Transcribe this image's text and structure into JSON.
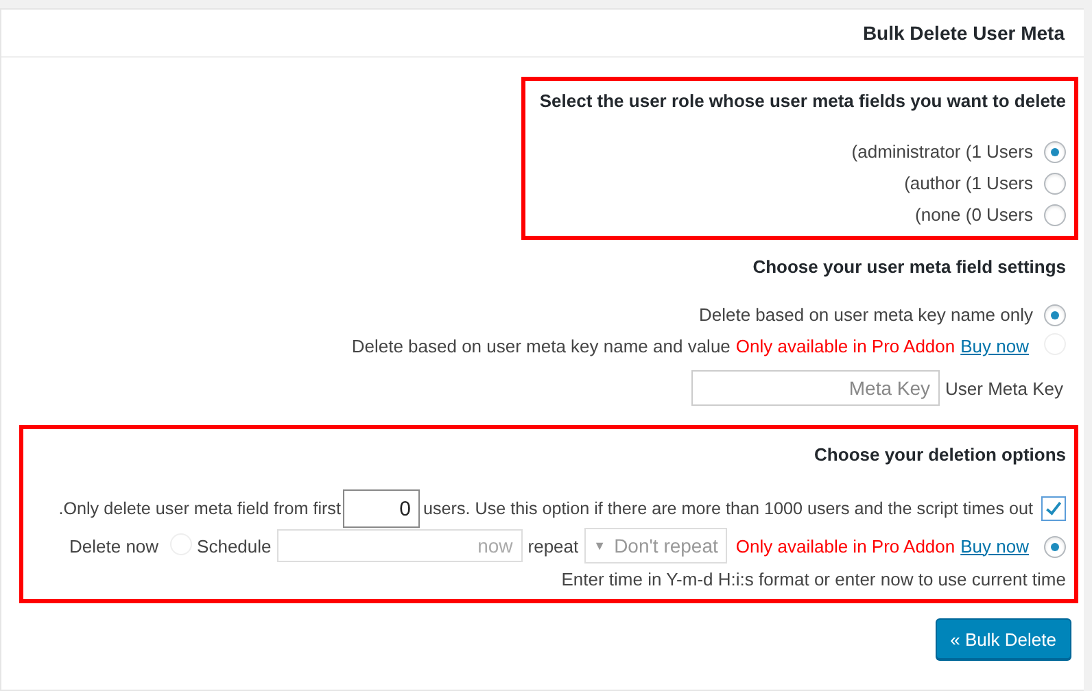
{
  "header": {
    "title": "Bulk Delete User Meta"
  },
  "role_section": {
    "highlighted": true,
    "title": "Select the user role whose user meta fields you want to delete",
    "roles": [
      {
        "label": "(administrator (1 Users",
        "selected": true
      },
      {
        "label": "(author (1 Users",
        "selected": false
      },
      {
        "label": "(none (0 Users",
        "selected": false
      }
    ]
  },
  "meta_section": {
    "highlighted": false,
    "title": "Choose your user meta field settings",
    "options": [
      {
        "label": "Delete based on user meta key name only",
        "selected": true,
        "disabled": false
      },
      {
        "label": "Delete based on user meta key name and value",
        "selected": false,
        "disabled": true,
        "pro_note": "Only available in Pro Addon",
        "link": "Buy now"
      }
    ],
    "meta_key": {
      "placeholder": "Meta Key",
      "label": "User Meta Key"
    }
  },
  "deletion_section": {
    "highlighted": true,
    "title": "Choose your deletion options",
    "limit": {
      "checked": true,
      "prefix": ".Only delete user meta field from first",
      "value": "0",
      "suffix": "users. Use this option if there are more than 1000 users and the script times out"
    },
    "schedule_row": [
      {
        "kind": "text",
        "text": "Delete now"
      },
      {
        "kind": "radio",
        "selected": false,
        "disabled": true
      },
      {
        "kind": "text",
        "text": "Schedule"
      },
      {
        "kind": "field",
        "placeholder": "now"
      },
      {
        "kind": "text",
        "text": "repeat"
      },
      {
        "kind": "select",
        "text": "Don't repeat",
        "arrow": "▼"
      },
      {
        "kind": "pro_note",
        "text": "Only available in Pro Addon"
      },
      {
        "kind": "link",
        "text": "Buy now"
      },
      {
        "kind": "radio",
        "selected": true,
        "disabled": false
      }
    ],
    "hint": "Enter time in Y-m-d H:i:s format or enter now to use current time"
  },
  "submit": {
    "label": "« Bulk Delete"
  }
}
